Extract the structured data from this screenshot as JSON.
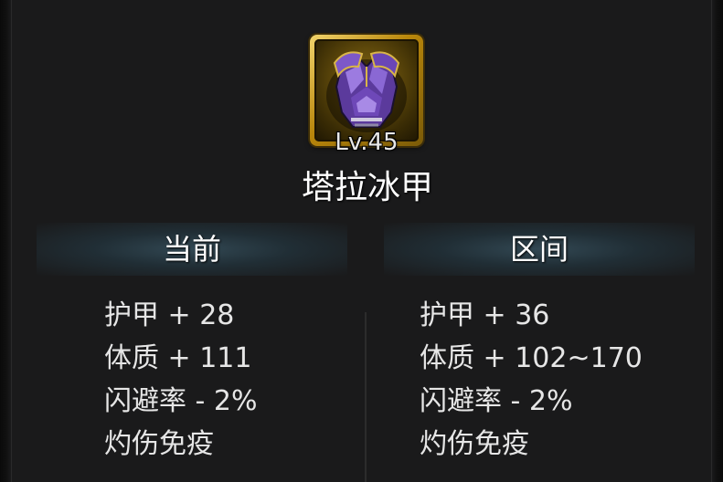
{
  "item": {
    "level_label": "Lv.45",
    "name": "塔拉冰甲",
    "icon": "purple-chest-armor-icon"
  },
  "columns": {
    "current_label": "当前",
    "range_label": "区间"
  },
  "current_stats": [
    "护甲 + 28",
    "体质 + 111",
    "闪避率 - 2%",
    "灼伤免疫"
  ],
  "range_stats": [
    "护甲 + 36",
    "体质 + 102~170",
    "闪避率 - 2%",
    "灼伤免疫"
  ],
  "colors": {
    "frame_gold": "#d4a72c",
    "armor_purple": "#7b4fc9",
    "header_teal": "#3e6a7e"
  }
}
